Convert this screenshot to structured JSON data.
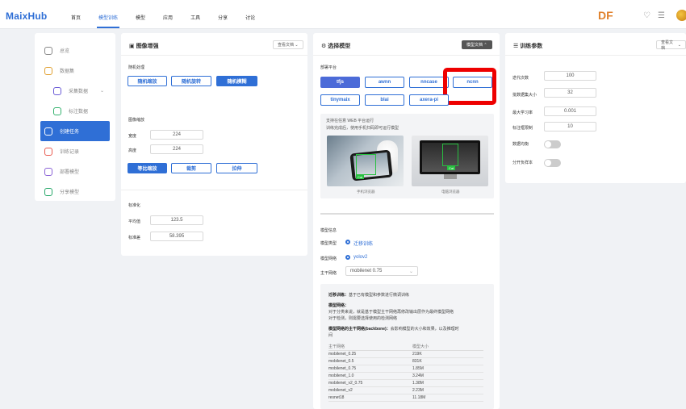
{
  "app": {
    "logo": "MaixHub"
  },
  "nav": {
    "items": [
      "首页",
      "模型训练",
      "模型",
      "应用",
      "工具",
      "分享",
      "讨论"
    ],
    "active": "模型训练"
  },
  "header": {
    "badge": "DF"
  },
  "sidebar": {
    "items": [
      {
        "label": "总览",
        "icon": "home-icon"
      },
      {
        "label": "数据集",
        "icon": "database-icon"
      },
      {
        "label": "采集数据",
        "icon": "collect-icon"
      },
      {
        "label": "标注数据",
        "icon": "annotate-icon"
      },
      {
        "label": "创建任务",
        "icon": "plus-icon"
      },
      {
        "label": "训练记录",
        "icon": "history-icon"
      },
      {
        "label": "部署模型",
        "icon": "deploy-icon"
      },
      {
        "label": "分享模型",
        "icon": "share-icon"
      }
    ]
  },
  "augment": {
    "title": "图像增强",
    "doc_btn": "查看文档",
    "process_label": "随机处理",
    "process_buttons": [
      "随机缩放",
      "随机旋转",
      "随机模糊"
    ],
    "resize_label": "图像缩放",
    "width_label": "宽度",
    "width_value": "224",
    "height_label": "高度",
    "height_value": "224",
    "resize_buttons": [
      "等比缩放",
      "裁剪",
      "拉伸"
    ],
    "normalize_label": "标准化",
    "mean_label": "平均值",
    "mean_value": "123.5",
    "std_label": "标准差",
    "std_value": "58.395"
  },
  "model_select": {
    "title": "选择模型",
    "doc_btn": "模型文档",
    "platform_label": "部署平台",
    "platforms_row1": [
      "tfjs",
      "awnn",
      "nncase",
      "ncnn"
    ],
    "platforms_row2": [
      "tinymaix",
      "blai",
      "axera-pi"
    ],
    "active_platform": "tfjs",
    "preview_line1": "支持在任意 WEB 平台运行",
    "preview_line2": "训练完成后，使用手机扫码即可运行模型",
    "detect_label": "Cat",
    "caption_phone": "手机浏览器",
    "caption_pc": "电脑浏览器",
    "algo_label": "模型信息",
    "type_label": "模型类型",
    "type_value": "迁移训练",
    "network_label": "模型网络",
    "network_value": "yolov2",
    "backbone_label": "主干网络",
    "backbone_value": "mobilenet 0.75",
    "explain": {
      "title_bold": "迁移训练：",
      "title_rest": "基于已有模型和参数进行微调训练",
      "net_bold": "模型网络：",
      "net_line1": "对于分类来说，就是基于模型主干网络再修改输出层作为最终模型网络",
      "net_line2": "对于检测，则需要选择使用的检测网络",
      "bb_bold": "模型网络的主干网络(backbone)：",
      "bb_rest": "会影响模型的大小和效果，以及推理时",
      "bb_rest2": "间"
    },
    "table": {
      "headers": [
        "主干网络",
        "模型大小"
      ],
      "rows": [
        [
          "mobilenet_0.25",
          "219K"
        ],
        [
          "mobilenet_0.5",
          "831K"
        ],
        [
          "mobilenet_0.75",
          "1.85M"
        ],
        [
          "mobilenet_1.0",
          "3.24M"
        ],
        [
          "mobilenet_v2_0.75",
          "1.38M"
        ],
        [
          "mobilenet_v2",
          "2.23M"
        ],
        [
          "resnet18",
          "11.18M"
        ]
      ]
    }
  },
  "train_params": {
    "title": "训练参数",
    "doc_btn": "查看文档",
    "epoch_label": "迭代次数",
    "epoch_value": "100",
    "batch_label": "批数据集大小",
    "batch_value": "32",
    "lr_label": "最大学习率",
    "lr_value": "0.001",
    "max_label": "标注框限制",
    "max_value": "10",
    "balance_label": "数据均衡",
    "bal_toggle_on": false,
    "other_label": "分开负样本",
    "other_toggle_on": false
  }
}
